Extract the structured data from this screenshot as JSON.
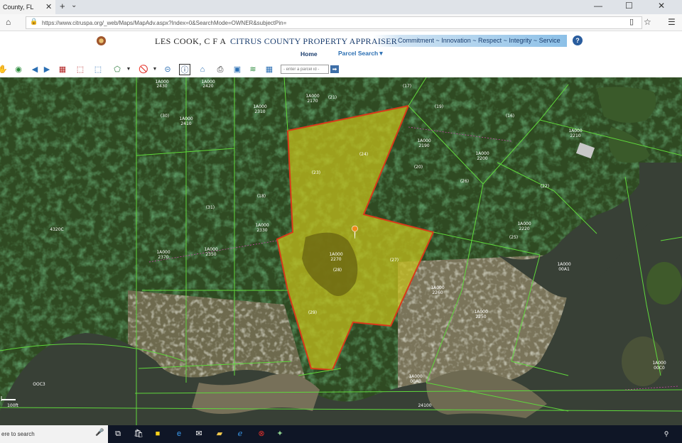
{
  "browser": {
    "tab_title": "County, FL",
    "tab_close": "✕",
    "new_tab": "+",
    "tab_list": "⌄",
    "minimize": "—",
    "maximize": "☐",
    "close": "✕",
    "url": "https://www.citruspa.org/_web/Maps/MapAdv.aspx?Index=0&SearchMode=OWNER&subjectPin="
  },
  "header": {
    "appraiser": "LES COOK, C F A",
    "title": "CITRUS COUNTY PROPERTY APPRAISER",
    "tagline": "Commitment ~ Innovation ~ Respect ~ Integrity ~ Service",
    "help": "?"
  },
  "nav": {
    "home": "Home",
    "parcel_search": "Parcel Search▼"
  },
  "toolbar": {
    "parcel_placeholder": "- enter a parcel id -",
    "go": "➡"
  },
  "map": {
    "scale_label": "100ft",
    "outside_label": "OOC3",
    "parcels": [
      {
        "id": "1A000",
        "num": "2430"
      },
      {
        "id": "1A000",
        "num": "2420"
      },
      {
        "id": "1A000",
        "num": "2410"
      },
      {
        "id": "1A000",
        "num": "2170"
      },
      {
        "id": "1A000",
        "num": "2310"
      },
      {
        "id": "1A000",
        "num": "2190"
      },
      {
        "id": "1A000",
        "num": "2200"
      },
      {
        "id": "1A000",
        "num": "2210"
      },
      {
        "id": "1A000",
        "num": "2370"
      },
      {
        "id": "1A000",
        "num": "2350"
      },
      {
        "id": "1A000",
        "num": "2330"
      },
      {
        "id": "1A000",
        "num": "2270"
      },
      {
        "id": "1A000",
        "num": "2220"
      },
      {
        "id": "1A000",
        "num": "00A1"
      },
      {
        "id": "1A000",
        "num": "2260"
      },
      {
        "id": "1A000",
        "num": "2250"
      },
      {
        "id": "1A000",
        "num": "00A0"
      },
      {
        "id": "1A000",
        "num": "00C0"
      }
    ],
    "tags": [
      "(24)",
      "(23)",
      "(21)",
      "(20)",
      "(26)",
      "(22)",
      "(25)",
      "(19)",
      "(17)",
      "(16)",
      "(18)",
      "(27)",
      "(28)",
      "(29)",
      "(30)",
      "(31)"
    ],
    "other_labels": [
      "4320C",
      "24100"
    ]
  },
  "taskbar": {
    "search_text": "ere to search",
    "mic": "🎤"
  },
  "colors": {
    "parcel_fill": "#c8c21c",
    "parcel_outline": "#d83a1a",
    "boundary": "#5fd83c",
    "brand_blue": "#1a3d6e"
  }
}
